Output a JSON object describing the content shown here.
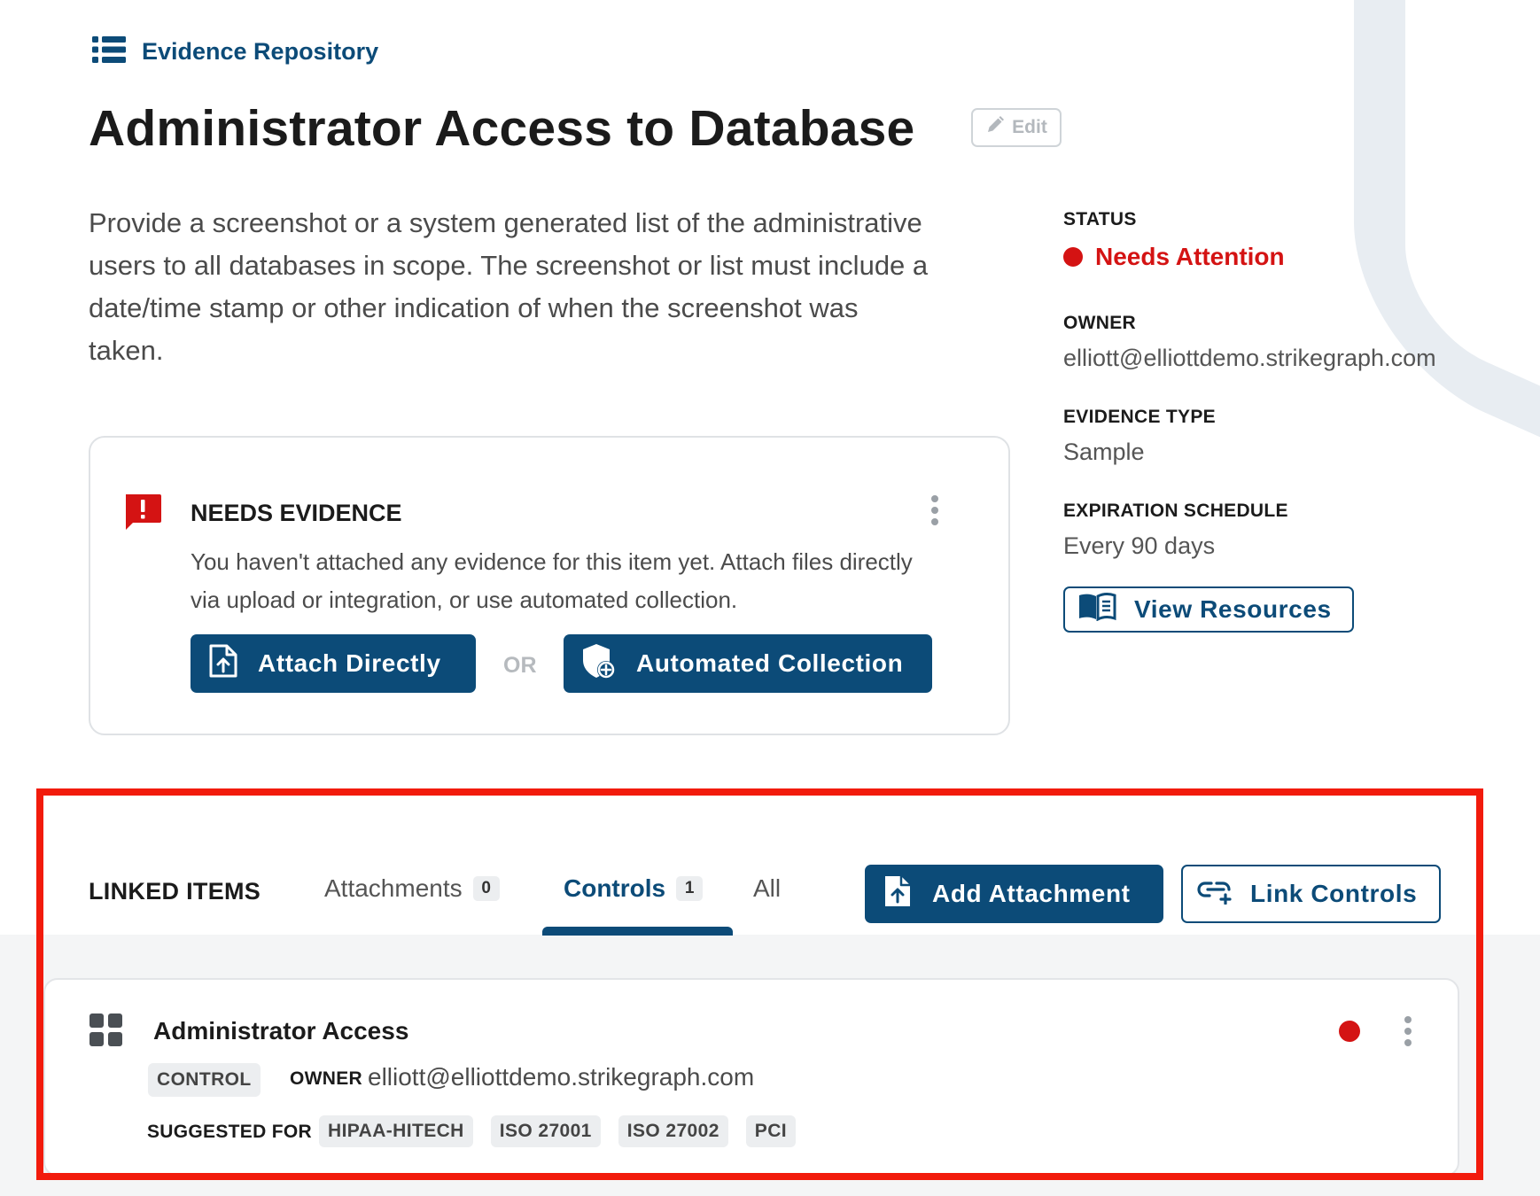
{
  "breadcrumb": {
    "icon": "list-icon",
    "label": "Evidence Repository"
  },
  "title": "Administrator Access to Database",
  "edit_label": "Edit",
  "description": "Provide a screenshot or a system generated list of the administrative users to all databases in scope. The screenshot or list must include a date/time stamp or other indication of when the screenshot was taken.",
  "evidence_card": {
    "title": "NEEDS EVIDENCE",
    "text": "You haven't attached any evidence for this item yet. Attach files directly via upload or integration, or use automated collection.",
    "attach_label": "Attach Directly",
    "or_label": "OR",
    "automated_label": "Automated Collection"
  },
  "meta": {
    "status_label": "STATUS",
    "status_value": "Needs Attention",
    "owner_label": "OWNER",
    "owner_value": "elliott@elliottdemo.strikegraph.com",
    "type_label": "EVIDENCE TYPE",
    "type_value": "Sample",
    "expiration_label": "EXPIRATION SCHEDULE",
    "expiration_value": "Every 90 days",
    "resources_label": "View Resources"
  },
  "linked": {
    "label": "LINKED ITEMS",
    "tabs": [
      {
        "label": "Attachments",
        "count": "0"
      },
      {
        "label": "Controls",
        "count": "1"
      },
      {
        "label": "All",
        "count": ""
      }
    ],
    "active_tab": "Controls",
    "add_attachment_label": "Add Attachment",
    "link_controls_label": "Link Controls"
  },
  "control": {
    "title": "Administrator Access",
    "tag": "CONTROL",
    "owner_label": "OWNER",
    "owner_value": "elliott@elliottdemo.strikegraph.com",
    "suggested_label": "SUGGESTED FOR",
    "frameworks": [
      "HIPAA-HITECH",
      "ISO 27001",
      "ISO 27002",
      "PCI"
    ]
  },
  "colors": {
    "brand": "#0c4b78",
    "alert": "#d41313",
    "highlight": "#f21b0c"
  }
}
